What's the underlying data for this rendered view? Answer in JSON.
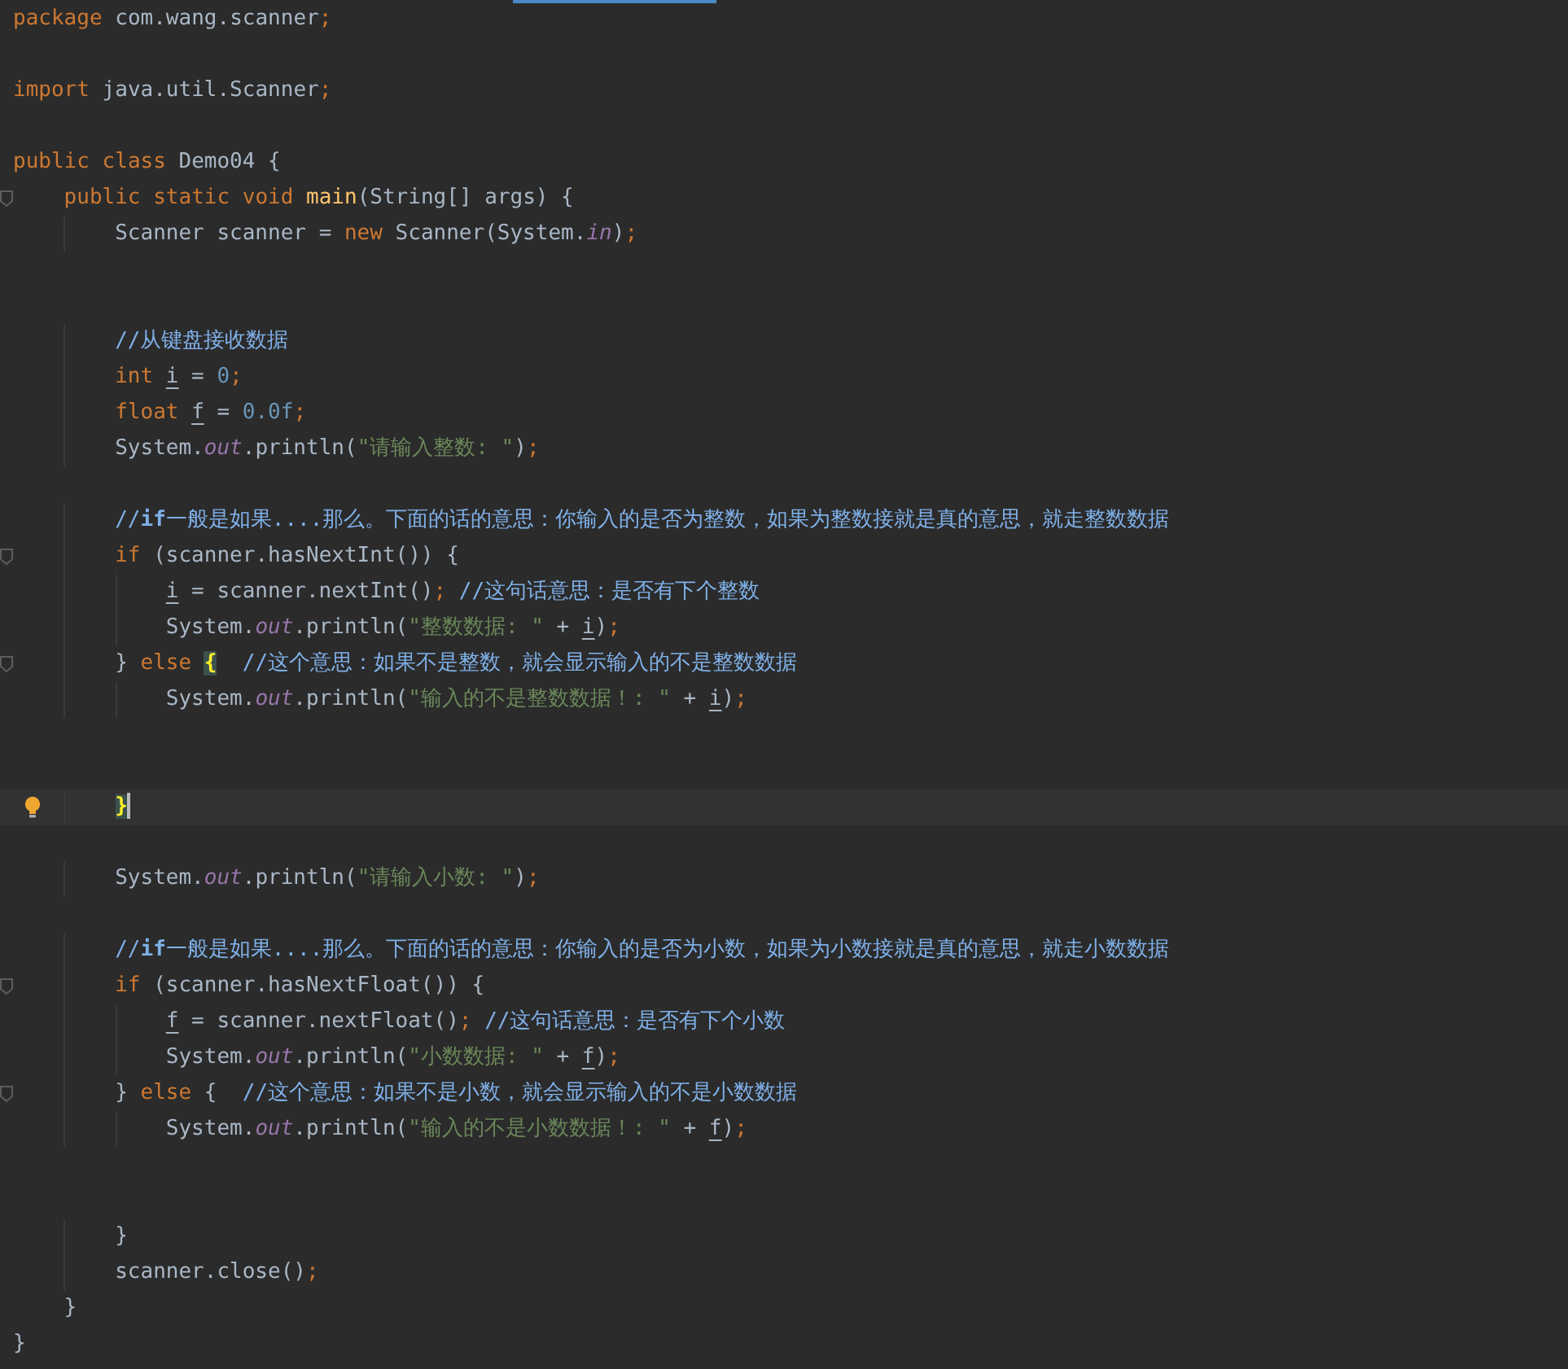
{
  "lines": [
    {
      "kind": "code",
      "tokens": [
        {
          "kind": "kw",
          "text": "package"
        },
        {
          "kind": "txt",
          "text": " com.wang.scanner"
        },
        {
          "kind": "punct",
          "text": ";"
        }
      ]
    },
    {
      "kind": "blank"
    },
    {
      "kind": "code",
      "tokens": [
        {
          "kind": "kw",
          "text": "import"
        },
        {
          "kind": "txt",
          "text": " java.util.Scanner"
        },
        {
          "kind": "punct",
          "text": ";"
        }
      ]
    },
    {
      "kind": "blank"
    },
    {
      "kind": "code",
      "tokens": [
        {
          "kind": "kw",
          "text": "public class"
        },
        {
          "kind": "txt",
          "text": " Demo04 {"
        }
      ],
      "children": [
        {
          "kind": "code",
          "fold": true,
          "tokens": [
            {
              "kind": "kw",
              "text": "public static void "
            },
            {
              "kind": "fn",
              "text": "main"
            },
            {
              "kind": "txt",
              "text": "(String[] args) {"
            }
          ],
          "children": [
            {
              "kind": "code",
              "tokens": [
                {
                  "kind": "txt",
                  "text": "Scanner scanner = "
                },
                {
                  "kind": "kw",
                  "text": "new"
                },
                {
                  "kind": "txt",
                  "text": " Scanner(System."
                },
                {
                  "kind": "field",
                  "text": "in"
                },
                {
                  "kind": "txt",
                  "text": ")"
                },
                {
                  "kind": "punct",
                  "text": ";"
                }
              ]
            },
            {
              "kind": "blank"
            },
            {
              "kind": "blank"
            },
            {
              "kind": "code",
              "tokens": [
                {
                  "kind": "comment",
                  "text": "//从键盘接收数据"
                }
              ]
            },
            {
              "kind": "code",
              "tokens": [
                {
                  "kind": "kw",
                  "text": "int "
                },
                {
                  "kind": "var",
                  "text": "i"
                },
                {
                  "kind": "txt",
                  "text": " = "
                },
                {
                  "kind": "num",
                  "text": "0"
                },
                {
                  "kind": "punct",
                  "text": ";"
                }
              ]
            },
            {
              "kind": "code",
              "tokens": [
                {
                  "kind": "kw",
                  "text": "float "
                },
                {
                  "kind": "var",
                  "text": "f"
                },
                {
                  "kind": "txt",
                  "text": " = "
                },
                {
                  "kind": "num",
                  "text": "0.0f"
                },
                {
                  "kind": "punct",
                  "text": ";"
                }
              ]
            },
            {
              "kind": "code",
              "tokens": [
                {
                  "kind": "txt",
                  "text": "System."
                },
                {
                  "kind": "field",
                  "text": "out"
                },
                {
                  "kind": "txt",
                  "text": ".println("
                },
                {
                  "kind": "str",
                  "text": "\"请输入整数: \""
                },
                {
                  "kind": "txt",
                  "text": ")"
                },
                {
                  "kind": "punct",
                  "text": ";"
                }
              ]
            },
            {
              "kind": "blank"
            },
            {
              "kind": "code",
              "tokens": [
                {
                  "kind": "comment",
                  "text": "//**if**一般是如果....那么。下面的话的意思：你输入的是否为整数，如果为整数接就是真的意思，就走整数数据"
                }
              ]
            },
            {
              "kind": "code",
              "fold": true,
              "tokens": [
                {
                  "kind": "kw",
                  "text": "if"
                },
                {
                  "kind": "txt",
                  "text": " (scanner.hasNextInt()) {"
                }
              ],
              "children": [
                {
                  "kind": "code",
                  "tokens": [
                    {
                      "kind": "var",
                      "text": "i"
                    },
                    {
                      "kind": "txt",
                      "text": " = scanner.nextInt()"
                    },
                    {
                      "kind": "punct",
                      "text": "; "
                    },
                    {
                      "kind": "comment",
                      "text": "//这句话意思：是否有下个整数"
                    }
                  ]
                },
                {
                  "kind": "code",
                  "tokens": [
                    {
                      "kind": "txt",
                      "text": "System."
                    },
                    {
                      "kind": "field",
                      "text": "out"
                    },
                    {
                      "kind": "txt",
                      "text": ".println("
                    },
                    {
                      "kind": "str",
                      "text": "\"整数数据: \""
                    },
                    {
                      "kind": "txt",
                      "text": " + "
                    },
                    {
                      "kind": "var",
                      "text": "i"
                    },
                    {
                      "kind": "txt",
                      "text": ")"
                    },
                    {
                      "kind": "punct",
                      "text": ";"
                    }
                  ]
                }
              ]
            },
            {
              "kind": "code",
              "fold": true,
              "tokens": [
                {
                  "kind": "txt",
                  "text": "} "
                },
                {
                  "kind": "kw",
                  "text": "else "
                },
                {
                  "kind": "match",
                  "text": "{"
                },
                {
                  "kind": "comment",
                  "text": "  //这个意思：如果不是整数，就会显示输入的不是整数数据"
                }
              ],
              "children": [
                {
                  "kind": "code",
                  "tokens": [
                    {
                      "kind": "txt",
                      "text": "System."
                    },
                    {
                      "kind": "field",
                      "text": "out"
                    },
                    {
                      "kind": "txt",
                      "text": ".println("
                    },
                    {
                      "kind": "str",
                      "text": "\"输入的不是整数数据！: \""
                    },
                    {
                      "kind": "txt",
                      "text": " + "
                    },
                    {
                      "kind": "var",
                      "text": "i"
                    },
                    {
                      "kind": "txt",
                      "text": ")"
                    },
                    {
                      "kind": "punct",
                      "text": ";"
                    }
                  ]
                },
                {
                  "kind": "blank"
                },
                {
                  "kind": "blank"
                }
              ]
            },
            {
              "kind": "code",
              "current": true,
              "bulb": true,
              "tokens": [
                {
                  "kind": "match",
                  "text": "}"
                }
              ]
            },
            {
              "kind": "blank"
            },
            {
              "kind": "code",
              "tokens": [
                {
                  "kind": "txt",
                  "text": "System."
                },
                {
                  "kind": "field",
                  "text": "out"
                },
                {
                  "kind": "txt",
                  "text": ".println("
                },
                {
                  "kind": "str",
                  "text": "\"请输入小数: \""
                },
                {
                  "kind": "txt",
                  "text": ")"
                },
                {
                  "kind": "punct",
                  "text": ";"
                }
              ]
            },
            {
              "kind": "blank"
            },
            {
              "kind": "code",
              "tokens": [
                {
                  "kind": "comment",
                  "text": "//**if**一般是如果....那么。下面的话的意思：你输入的是否为小数，如果为小数接就是真的意思，就走小数数据"
                }
              ]
            },
            {
              "kind": "code",
              "fold": true,
              "tokens": [
                {
                  "kind": "kw",
                  "text": "if"
                },
                {
                  "kind": "txt",
                  "text": " (scanner.hasNextFloat()) {"
                }
              ],
              "children": [
                {
                  "kind": "code",
                  "tokens": [
                    {
                      "kind": "var",
                      "text": "f"
                    },
                    {
                      "kind": "txt",
                      "text": " = scanner.nextFloat()"
                    },
                    {
                      "kind": "punct",
                      "text": "; "
                    },
                    {
                      "kind": "comment",
                      "text": "//这句话意思：是否有下个小数"
                    }
                  ]
                },
                {
                  "kind": "code",
                  "tokens": [
                    {
                      "kind": "txt",
                      "text": "System."
                    },
                    {
                      "kind": "field",
                      "text": "out"
                    },
                    {
                      "kind": "txt",
                      "text": ".println("
                    },
                    {
                      "kind": "str",
                      "text": "\"小数数据: \""
                    },
                    {
                      "kind": "txt",
                      "text": " + "
                    },
                    {
                      "kind": "var",
                      "text": "f"
                    },
                    {
                      "kind": "txt",
                      "text": ")"
                    },
                    {
                      "kind": "punct",
                      "text": ";"
                    }
                  ]
                }
              ]
            },
            {
              "kind": "code",
              "fold": true,
              "tokens": [
                {
                  "kind": "txt",
                  "text": "} "
                },
                {
                  "kind": "kw",
                  "text": "else"
                },
                {
                  "kind": "txt",
                  "text": " {  "
                },
                {
                  "kind": "comment",
                  "text": "//这个意思：如果不是小数，就会显示输入的不是小数数据"
                }
              ],
              "children": [
                {
                  "kind": "code",
                  "tokens": [
                    {
                      "kind": "txt",
                      "text": "System."
                    },
                    {
                      "kind": "field",
                      "text": "out"
                    },
                    {
                      "kind": "txt",
                      "text": ".println("
                    },
                    {
                      "kind": "str",
                      "text": "\"输入的不是小数数据！: \""
                    },
                    {
                      "kind": "txt",
                      "text": " + "
                    },
                    {
                      "kind": "var",
                      "text": "f"
                    },
                    {
                      "kind": "txt",
                      "text": ")"
                    },
                    {
                      "kind": "punct",
                      "text": ";"
                    }
                  ]
                },
                {
                  "kind": "blank"
                },
                {
                  "kind": "blank"
                }
              ]
            },
            {
              "kind": "code",
              "tokens": [
                {
                  "kind": "txt",
                  "text": "}"
                }
              ]
            },
            {
              "kind": "code",
              "tokens": [
                {
                  "kind": "txt",
                  "text": "scanner.close()"
                },
                {
                  "kind": "punct",
                  "text": ";"
                }
              ]
            }
          ]
        },
        {
          "kind": "code",
          "tokens": [
            {
              "kind": "txt",
              "text": "}"
            }
          ]
        }
      ]
    },
    {
      "kind": "code",
      "tokens": [
        {
          "kind": "txt",
          "text": "}"
        }
      ]
    }
  ]
}
